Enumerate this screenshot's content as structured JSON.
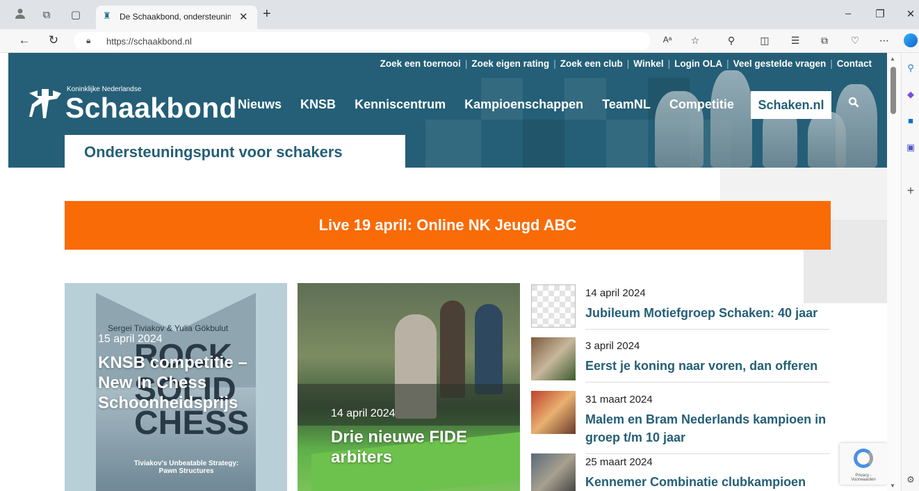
{
  "browser": {
    "tab_title": "De Schaakbond, ondersteuningsp",
    "url": "https://schaakbond.nl",
    "reader_icon_label": "Aᵃ"
  },
  "site": {
    "top_links": [
      "Zoek een toernooi",
      "Zoek eigen rating",
      "Zoek een club",
      "Winkel",
      "Login OLA",
      "Veel gestelde vragen",
      "Contact"
    ],
    "logo_small": "Koninklijke Nederlandse",
    "logo_big": "Schaakbond",
    "nav": [
      "Nieuws",
      "KNSB",
      "Kenniscentrum",
      "Kampioenschappen",
      "TeamNL",
      "Competitie"
    ],
    "nav_cta": "Schaken.nl",
    "tagline": "Ondersteuningspunt voor schakers",
    "banner": "Live 19 april: Online NK Jeugd ABC",
    "cards": [
      {
        "date": "15 april 2024",
        "title": "KNSB competitie – New In Chess Schoonheidsprijs",
        "cover_authors": "Sergei Tiviakov & Yulia Gökbulut",
        "cover_title": "ROCK SOLID CHESS",
        "cover_subtitle": "Tiviakov's Unbeatable Strategy: Pawn Structures"
      },
      {
        "date": "14 april 2024",
        "title": "Drie nieuwe FIDE arbiters"
      }
    ],
    "news": [
      {
        "date": "14 april 2024",
        "title": "Jubileum Motiefgroep Schaken: 40 jaar"
      },
      {
        "date": "3 april 2024",
        "title": "Eerst je koning naar voren, dan offeren"
      },
      {
        "date": "31 maart 2024",
        "title": "Malem en Bram Nederlands kampioen in groep t/m 10 jaar"
      },
      {
        "date": "25 maart 2024",
        "title": "Kennemer Combinatie clubkampioen"
      }
    ],
    "recaptcha_text": "Privacy - Voorwaarden"
  }
}
